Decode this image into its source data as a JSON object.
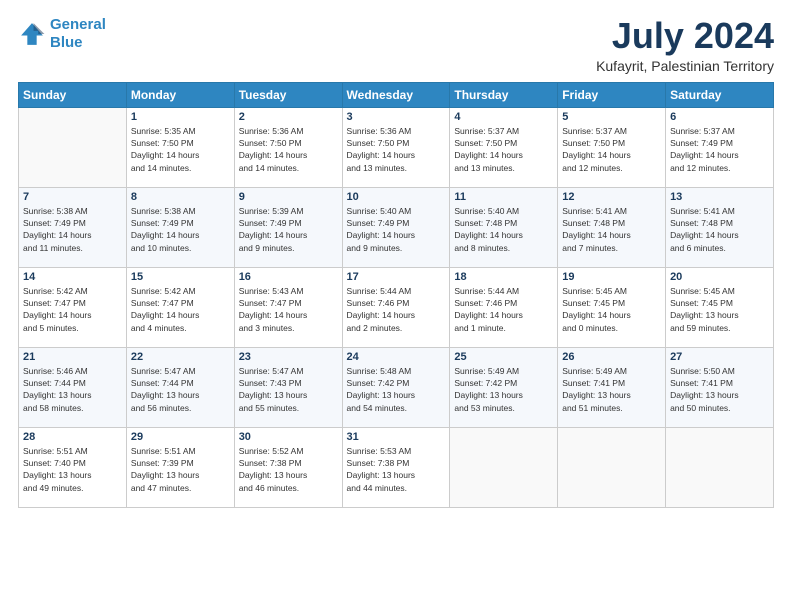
{
  "logo": {
    "line1": "General",
    "line2": "Blue"
  },
  "title": "July 2024",
  "subtitle": "Kufayrit, Palestinian Territory",
  "weekdays": [
    "Sunday",
    "Monday",
    "Tuesday",
    "Wednesday",
    "Thursday",
    "Friday",
    "Saturday"
  ],
  "weeks": [
    [
      {
        "day": "",
        "info": ""
      },
      {
        "day": "1",
        "info": "Sunrise: 5:35 AM\nSunset: 7:50 PM\nDaylight: 14 hours\nand 14 minutes."
      },
      {
        "day": "2",
        "info": "Sunrise: 5:36 AM\nSunset: 7:50 PM\nDaylight: 14 hours\nand 14 minutes."
      },
      {
        "day": "3",
        "info": "Sunrise: 5:36 AM\nSunset: 7:50 PM\nDaylight: 14 hours\nand 13 minutes."
      },
      {
        "day": "4",
        "info": "Sunrise: 5:37 AM\nSunset: 7:50 PM\nDaylight: 14 hours\nand 13 minutes."
      },
      {
        "day": "5",
        "info": "Sunrise: 5:37 AM\nSunset: 7:50 PM\nDaylight: 14 hours\nand 12 minutes."
      },
      {
        "day": "6",
        "info": "Sunrise: 5:37 AM\nSunset: 7:49 PM\nDaylight: 14 hours\nand 12 minutes."
      }
    ],
    [
      {
        "day": "7",
        "info": "Sunrise: 5:38 AM\nSunset: 7:49 PM\nDaylight: 14 hours\nand 11 minutes."
      },
      {
        "day": "8",
        "info": "Sunrise: 5:38 AM\nSunset: 7:49 PM\nDaylight: 14 hours\nand 10 minutes."
      },
      {
        "day": "9",
        "info": "Sunrise: 5:39 AM\nSunset: 7:49 PM\nDaylight: 14 hours\nand 9 minutes."
      },
      {
        "day": "10",
        "info": "Sunrise: 5:40 AM\nSunset: 7:49 PM\nDaylight: 14 hours\nand 9 minutes."
      },
      {
        "day": "11",
        "info": "Sunrise: 5:40 AM\nSunset: 7:48 PM\nDaylight: 14 hours\nand 8 minutes."
      },
      {
        "day": "12",
        "info": "Sunrise: 5:41 AM\nSunset: 7:48 PM\nDaylight: 14 hours\nand 7 minutes."
      },
      {
        "day": "13",
        "info": "Sunrise: 5:41 AM\nSunset: 7:48 PM\nDaylight: 14 hours\nand 6 minutes."
      }
    ],
    [
      {
        "day": "14",
        "info": "Sunrise: 5:42 AM\nSunset: 7:47 PM\nDaylight: 14 hours\nand 5 minutes."
      },
      {
        "day": "15",
        "info": "Sunrise: 5:42 AM\nSunset: 7:47 PM\nDaylight: 14 hours\nand 4 minutes."
      },
      {
        "day": "16",
        "info": "Sunrise: 5:43 AM\nSunset: 7:47 PM\nDaylight: 14 hours\nand 3 minutes."
      },
      {
        "day": "17",
        "info": "Sunrise: 5:44 AM\nSunset: 7:46 PM\nDaylight: 14 hours\nand 2 minutes."
      },
      {
        "day": "18",
        "info": "Sunrise: 5:44 AM\nSunset: 7:46 PM\nDaylight: 14 hours\nand 1 minute."
      },
      {
        "day": "19",
        "info": "Sunrise: 5:45 AM\nSunset: 7:45 PM\nDaylight: 14 hours\nand 0 minutes."
      },
      {
        "day": "20",
        "info": "Sunrise: 5:45 AM\nSunset: 7:45 PM\nDaylight: 13 hours\nand 59 minutes."
      }
    ],
    [
      {
        "day": "21",
        "info": "Sunrise: 5:46 AM\nSunset: 7:44 PM\nDaylight: 13 hours\nand 58 minutes."
      },
      {
        "day": "22",
        "info": "Sunrise: 5:47 AM\nSunset: 7:44 PM\nDaylight: 13 hours\nand 56 minutes."
      },
      {
        "day": "23",
        "info": "Sunrise: 5:47 AM\nSunset: 7:43 PM\nDaylight: 13 hours\nand 55 minutes."
      },
      {
        "day": "24",
        "info": "Sunrise: 5:48 AM\nSunset: 7:42 PM\nDaylight: 13 hours\nand 54 minutes."
      },
      {
        "day": "25",
        "info": "Sunrise: 5:49 AM\nSunset: 7:42 PM\nDaylight: 13 hours\nand 53 minutes."
      },
      {
        "day": "26",
        "info": "Sunrise: 5:49 AM\nSunset: 7:41 PM\nDaylight: 13 hours\nand 51 minutes."
      },
      {
        "day": "27",
        "info": "Sunrise: 5:50 AM\nSunset: 7:41 PM\nDaylight: 13 hours\nand 50 minutes."
      }
    ],
    [
      {
        "day": "28",
        "info": "Sunrise: 5:51 AM\nSunset: 7:40 PM\nDaylight: 13 hours\nand 49 minutes."
      },
      {
        "day": "29",
        "info": "Sunrise: 5:51 AM\nSunset: 7:39 PM\nDaylight: 13 hours\nand 47 minutes."
      },
      {
        "day": "30",
        "info": "Sunrise: 5:52 AM\nSunset: 7:38 PM\nDaylight: 13 hours\nand 46 minutes."
      },
      {
        "day": "31",
        "info": "Sunrise: 5:53 AM\nSunset: 7:38 PM\nDaylight: 13 hours\nand 44 minutes."
      },
      {
        "day": "",
        "info": ""
      },
      {
        "day": "",
        "info": ""
      },
      {
        "day": "",
        "info": ""
      }
    ]
  ]
}
